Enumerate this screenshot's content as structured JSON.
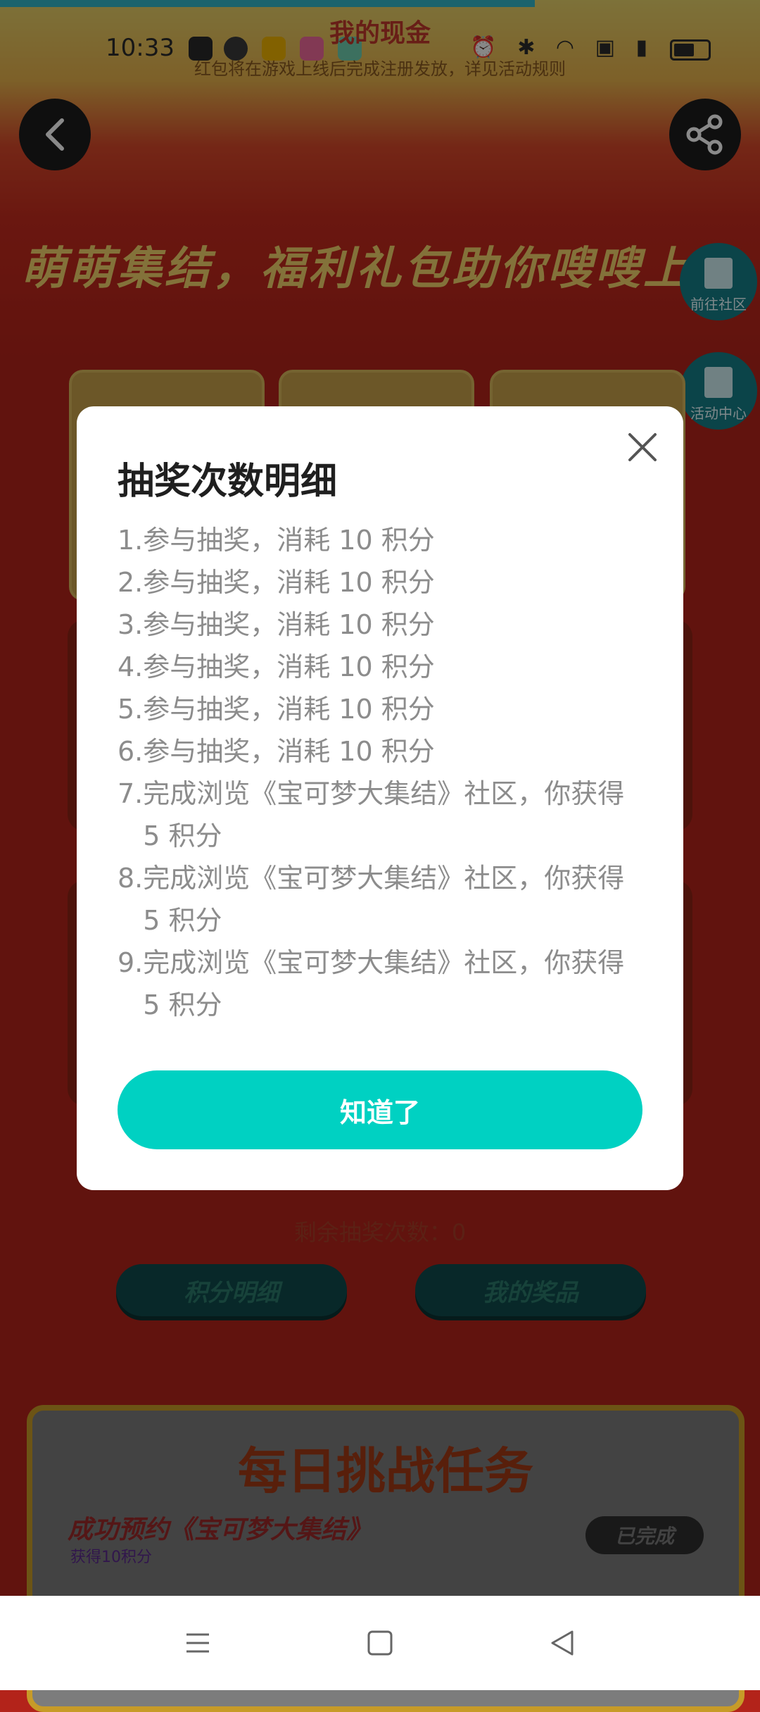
{
  "status_bar": {
    "time": "10:33",
    "icons": [
      "alarm-icon",
      "bluetooth-icon",
      "wifi-icon",
      "hd-icon",
      "5g-signal-icon",
      "battery-icon"
    ]
  },
  "page": {
    "header_title": "我的现金",
    "header_subtitle": "红包将在游戏上线后完成注册发放，详见活动规则",
    "banner_title": "萌萌集结，福利礼包助你嗖嗖上分",
    "side_buttons": [
      "前往社区",
      "活动中心"
    ],
    "remaining_draws": "剩余抽奖次数：0",
    "pill_buttons": [
      "积分明细",
      "我的奖品"
    ],
    "daily_tasks": {
      "title": "每日挑战任务",
      "task_name": "成功预约《宝可梦大集结》",
      "task_reward": "获得10积分",
      "task_status": "已完成"
    }
  },
  "modal": {
    "title": "抽奖次数明细",
    "items": [
      {
        "num": "1.",
        "text": "参与抽奖，消耗 10 积分"
      },
      {
        "num": "2.",
        "text": "参与抽奖，消耗 10 积分"
      },
      {
        "num": "3.",
        "text": "参与抽奖，消耗 10 积分"
      },
      {
        "num": "4.",
        "text": "参与抽奖，消耗 10 积分"
      },
      {
        "num": "5.",
        "text": "参与抽奖，消耗 10 积分"
      },
      {
        "num": "6.",
        "text": "参与抽奖，消耗 10 积分"
      },
      {
        "num": "7.",
        "text": "完成浏览《宝可梦大集结》社区，你获得 5 积分"
      },
      {
        "num": "8.",
        "text": "完成浏览《宝可梦大集结》社区，你获得 5 积分"
      },
      {
        "num": "9.",
        "text": "完成浏览《宝可梦大集结》社区，你获得 5 积分"
      }
    ],
    "confirm_label": "知道了"
  },
  "colors": {
    "accent": "#00d1c2",
    "background": "#b3231a",
    "modal_text": "#8c8c8c"
  }
}
